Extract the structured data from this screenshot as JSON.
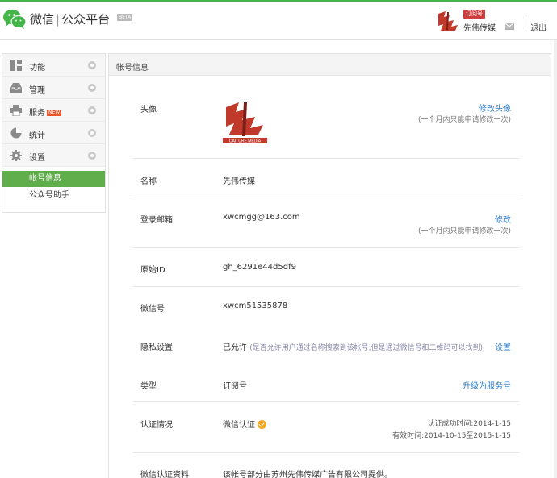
{
  "header": {
    "brand_wechat": "微信",
    "brand_sep": "|",
    "brand_platform": "公众平台",
    "beta": "BETA",
    "badge": "订阅号",
    "account_name": "先伟传媒",
    "logout": "退出"
  },
  "sidebar": {
    "items": [
      {
        "label": "功能",
        "icon": "grid-icon"
      },
      {
        "label": "管理",
        "icon": "inbox-icon"
      },
      {
        "label": "服务",
        "icon": "printer-icon",
        "tag": "NEW"
      },
      {
        "label": "统计",
        "icon": "pie-chart-icon"
      },
      {
        "label": "设置",
        "icon": "gear-icon"
      }
    ],
    "sub_items": [
      {
        "label": "帐号信息",
        "active": true
      },
      {
        "label": "公众号助手",
        "active": false
      }
    ]
  },
  "panel": {
    "title": "帐号信息",
    "rows": {
      "avatar": {
        "label": "头像",
        "link": "修改头像",
        "hint": "(一个月内只能申请修改一次)"
      },
      "name": {
        "label": "名称",
        "value": "先伟传媒"
      },
      "email": {
        "label": "登录邮箱",
        "value": "xwcmgg@163.com",
        "link": "修改",
        "hint": "(一个月内只能申请修改一次)"
      },
      "origin_id": {
        "label": "原始ID",
        "value": "gh_6291e44d5df9"
      },
      "wechat_id": {
        "label": "微信号",
        "value": "xwcm51535878"
      },
      "privacy": {
        "label": "隐私设置",
        "value": "已允许",
        "note": "(是否允许用户通过名称搜索到该帐号,但是通过微信号和二维码可以找到)",
        "link": "设置"
      },
      "type": {
        "label": "类型",
        "value": "订阅号",
        "link": "升级为服务号"
      },
      "verify": {
        "label": "认证情况",
        "value": "微信认证",
        "line1": "认证成功时间:2014-1-15",
        "line2": "有效时间:2014-10-15至2015-1-15"
      },
      "verify_info": {
        "label": "微信认证资料",
        "value": "该帐号部分由苏州先伟传媒广告有限公司提供。"
      }
    }
  }
}
